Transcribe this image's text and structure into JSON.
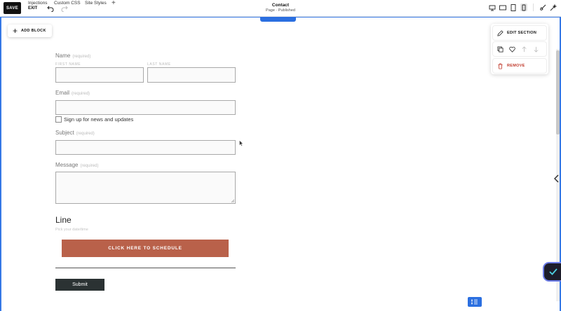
{
  "toolbar": {
    "save_label": "SAVE",
    "exit_label": "EXIT",
    "links": [
      "Injections",
      "Custom CSS",
      "Site Styles"
    ],
    "plus": "+",
    "page_title": "Contact",
    "page_status": "Page · Published"
  },
  "icons": [
    "undo-icon",
    "redo-icon",
    "desktop-icon",
    "tablet-landscape-icon",
    "tablet-portrait-icon",
    "mobile-icon",
    "paint-brush-icon",
    "magic-wand-icon"
  ],
  "add_block": {
    "label": "ADD BLOCK"
  },
  "form": {
    "name_label": "Name",
    "name_required": "(required)",
    "first_name_label": "FIRST NAME",
    "last_name_label": "LAST NAME",
    "email_label": "Email",
    "email_required": "(required)",
    "newsletter_label": "Sign up for news and updates",
    "subject_label": "Subject",
    "subject_required": "(required)",
    "message_label": "Message",
    "message_required": "(required)",
    "line_heading": "Line",
    "line_subtext": "Pick your date/time",
    "schedule_label": "CLICK HERE TO SCHEDULE",
    "submit_label": "Submit"
  },
  "section_panel": {
    "edit_label": "EDIT SECTION",
    "remove_label": "REMOVE"
  },
  "colors": {
    "accent_blue": "#2b6fe0",
    "schedule_button": "#b9614a",
    "submit_button": "#2b3233",
    "remove_red": "#c0392b"
  }
}
